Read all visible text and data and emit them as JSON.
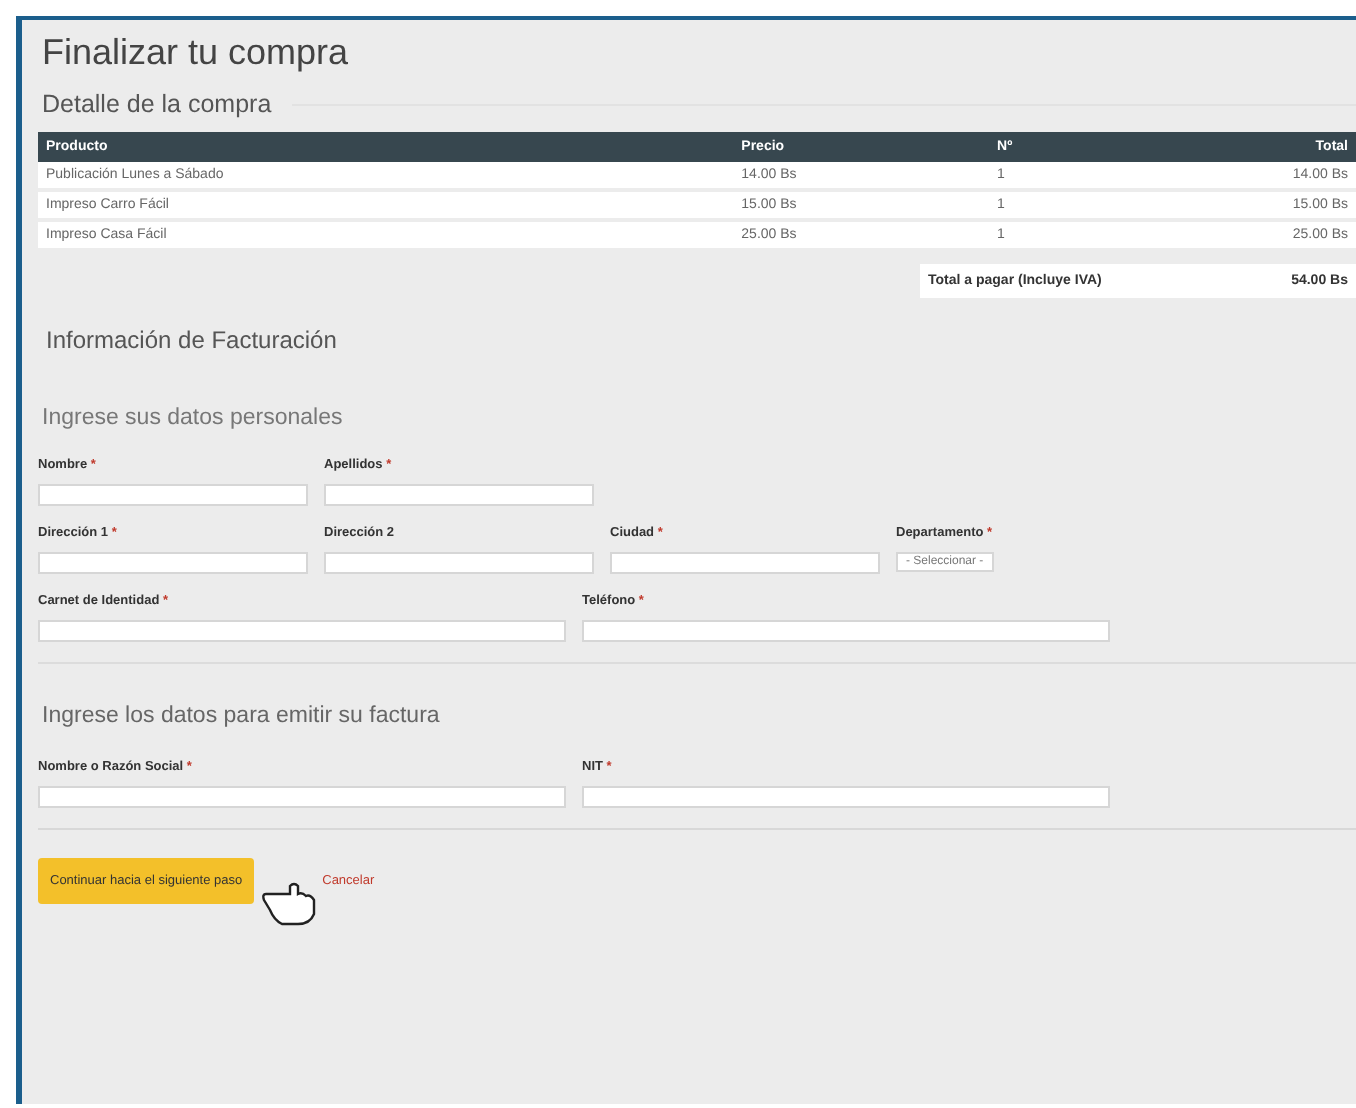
{
  "title": "Finalizar tu compra",
  "detail": {
    "heading": "Detalle de la compra",
    "columns": [
      "Producto",
      "Precio",
      "Nº",
      "Total"
    ],
    "rows": [
      [
        "Publicación Lunes a Sábado",
        "14.00 Bs",
        "1",
        "14.00 Bs"
      ],
      [
        "Impreso Carro Fácil",
        "15.00 Bs",
        "1",
        "15.00 Bs"
      ],
      [
        "Impreso Casa Fácil",
        "25.00 Bs",
        "1",
        "25.00 Bs"
      ]
    ],
    "total_label": "Total a pagar (Incluye IVA)",
    "total_value": "54.00 Bs"
  },
  "billing": {
    "heading": "Información de Facturación",
    "personal": {
      "heading": "Ingrese sus datos personales",
      "field_groups": [
        {
          "fields": [
            {
              "label": "Nombre",
              "required_mark": "*",
              "kind": "text"
            },
            {
              "label": "Apellidos",
              "required_mark": "*",
              "kind": "text"
            }
          ]
        },
        {
          "fields": [
            {
              "label": "Dirección 1",
              "required_mark": "*",
              "kind": "text"
            },
            {
              "label": "Dirección 2",
              "kind": "text"
            },
            {
              "label": "Ciudad",
              "required_mark": "*",
              "kind": "text"
            },
            {
              "label": "Departamento",
              "required_mark": "*",
              "kind": "select",
              "value": "- Seleccionar -"
            }
          ]
        },
        {
          "fields": [
            {
              "label": "Carnet de Identidad",
              "required_mark": "*",
              "kind": "wide"
            },
            {
              "label": "Teléfono",
              "required_mark": "*",
              "kind": "wide"
            }
          ]
        }
      ]
    },
    "invoice": {
      "heading": "Ingrese los datos para emitir su factura",
      "field_groups": [
        {
          "fields": [
            {
              "label": "Nombre o Razón Social",
              "required_mark": "*",
              "kind": "wide"
            },
            {
              "label": "NIT",
              "required_mark": "*",
              "kind": "wide"
            }
          ]
        }
      ]
    }
  },
  "actions": {
    "continue": "Continuar hacia el siguiente paso",
    "cancel": "Cancelar"
  }
}
